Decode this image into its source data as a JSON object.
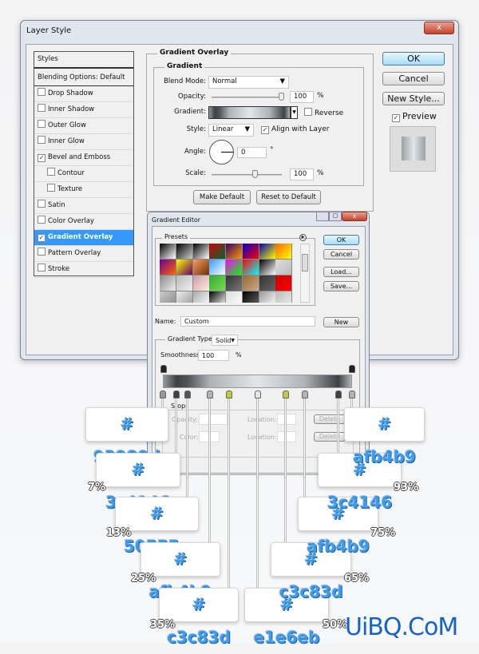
{
  "layer_style": {
    "title": "Layer Style",
    "close": "x",
    "styles_header": "Styles",
    "blending": "Blending Options: Default",
    "items": [
      {
        "label": "Drop Shadow",
        "checked": false
      },
      {
        "label": "Inner Shadow",
        "checked": false
      },
      {
        "label": "Outer Glow",
        "checked": false
      },
      {
        "label": "Inner Glow",
        "checked": false
      },
      {
        "label": "Bevel and Emboss",
        "checked": true
      },
      {
        "label": "Contour",
        "checked": false,
        "sub": true
      },
      {
        "label": "Texture",
        "checked": false,
        "sub": true
      },
      {
        "label": "Satin",
        "checked": false
      },
      {
        "label": "Color Overlay",
        "checked": false
      },
      {
        "label": "Gradient Overlay",
        "checked": true,
        "selected": true
      },
      {
        "label": "Pattern Overlay",
        "checked": false
      },
      {
        "label": "Stroke",
        "checked": false
      }
    ],
    "group_title": "Gradient Overlay",
    "sub_title": "Gradient",
    "blend_mode_label": "Blend Mode:",
    "blend_mode": "Normal",
    "opacity_label": "Opacity:",
    "opacity": "100",
    "pct": "%",
    "gradient_label": "Gradient:",
    "reverse": "Reverse",
    "style_label": "Style:",
    "style": "Linear",
    "align": "Align with Layer",
    "angle_label": "Angle:",
    "angle": "0",
    "deg": "°",
    "scale_label": "Scale:",
    "scale": "100",
    "make_default": "Make Default",
    "reset_default": "Reset to Default",
    "ok": "OK",
    "cancel": "Cancel",
    "new_style": "New Style...",
    "preview": "Preview"
  },
  "gradient_editor": {
    "title": "Gradient Editor",
    "presets": "Presets",
    "ok": "OK",
    "cancel": "Cancel",
    "load": "Load...",
    "save": "Save...",
    "name_label": "Name:",
    "name": "Custom",
    "new": "New",
    "type_label": "Gradient Type:",
    "type": "Solid",
    "smooth_label": "Smoothness:",
    "smooth": "100",
    "pct": "%",
    "stops": "Stops",
    "opacity_label": "Opacity:",
    "color_label": "Color:",
    "location_label": "Location:",
    "delete": "Delete",
    "preset_colors": [
      [
        "#000",
        "#fff"
      ],
      [
        "#000",
        "#ccc"
      ],
      [
        "#000",
        "#fff"
      ],
      [
        "#c00",
        "#063"
      ],
      [
        "#306",
        "#f90"
      ],
      [
        "#00c",
        "#f00"
      ],
      [
        "#00a",
        "#ff0"
      ],
      [
        "#f60",
        "#ff0"
      ],
      [
        "#609",
        "#f60"
      ],
      [
        "#ff0",
        "#606"
      ],
      [
        "#f96",
        "#630"
      ],
      [
        "#39f",
        "#fff"
      ],
      [
        "#f0f",
        "#0f0"
      ],
      [
        "#f00",
        "#0ff"
      ],
      [
        "#000",
        "#fff"
      ],
      [
        "#ddd",
        "#bbb"
      ],
      [
        "#888",
        "#eee"
      ],
      [
        "#bbb",
        "#eee"
      ],
      [
        "#c9a",
        "#fed"
      ],
      [
        "#3a3",
        "#7d5"
      ],
      [
        "#333",
        "#777"
      ],
      [
        "#963",
        "#ca8"
      ],
      [
        "#333",
        "#666"
      ],
      [
        "#c00",
        "#f00"
      ],
      [
        "#ccc",
        "#888"
      ],
      [
        "#eee",
        "#999"
      ],
      [
        "#aaa",
        "#fff"
      ],
      [
        "#000",
        "#fff"
      ],
      [
        "#ddd",
        "#fff"
      ],
      [
        "#000",
        "#666"
      ],
      [
        "#999",
        "#fff"
      ],
      [
        "#bbb",
        "#eee"
      ]
    ]
  },
  "gradient_stops": [
    {
      "location": 0,
      "color": "#93989d",
      "label": "# 93989d"
    },
    {
      "location": 7,
      "color": "#3c4146",
      "label": "# 3c4146",
      "pct": "7%"
    },
    {
      "location": 13,
      "color": "#50555a",
      "label": "# 50555a",
      "pct": "13%"
    },
    {
      "location": 25,
      "color": "#afb4b9",
      "label": "# afb4b9",
      "pct": "25%"
    },
    {
      "location": 35,
      "color": "#c3c83d",
      "label": "# c3c83d",
      "pct": "35%"
    },
    {
      "location": 50,
      "color": "#e1e6eb",
      "label": "# e1e6eb",
      "pct": "50%"
    },
    {
      "location": 65,
      "color": "#c3c83d",
      "label": "# c3c83d",
      "pct": "65%"
    },
    {
      "location": 75,
      "color": "#afb4b9",
      "label": "# afb4b9",
      "pct": "75%"
    },
    {
      "location": 93,
      "color": "#3c4146",
      "label": "# 3c4146",
      "pct": "93%"
    },
    {
      "location": 100,
      "color": "#afb4b9",
      "label": "# afb4b9"
    }
  ],
  "watermark": "UiBQ.CoM"
}
